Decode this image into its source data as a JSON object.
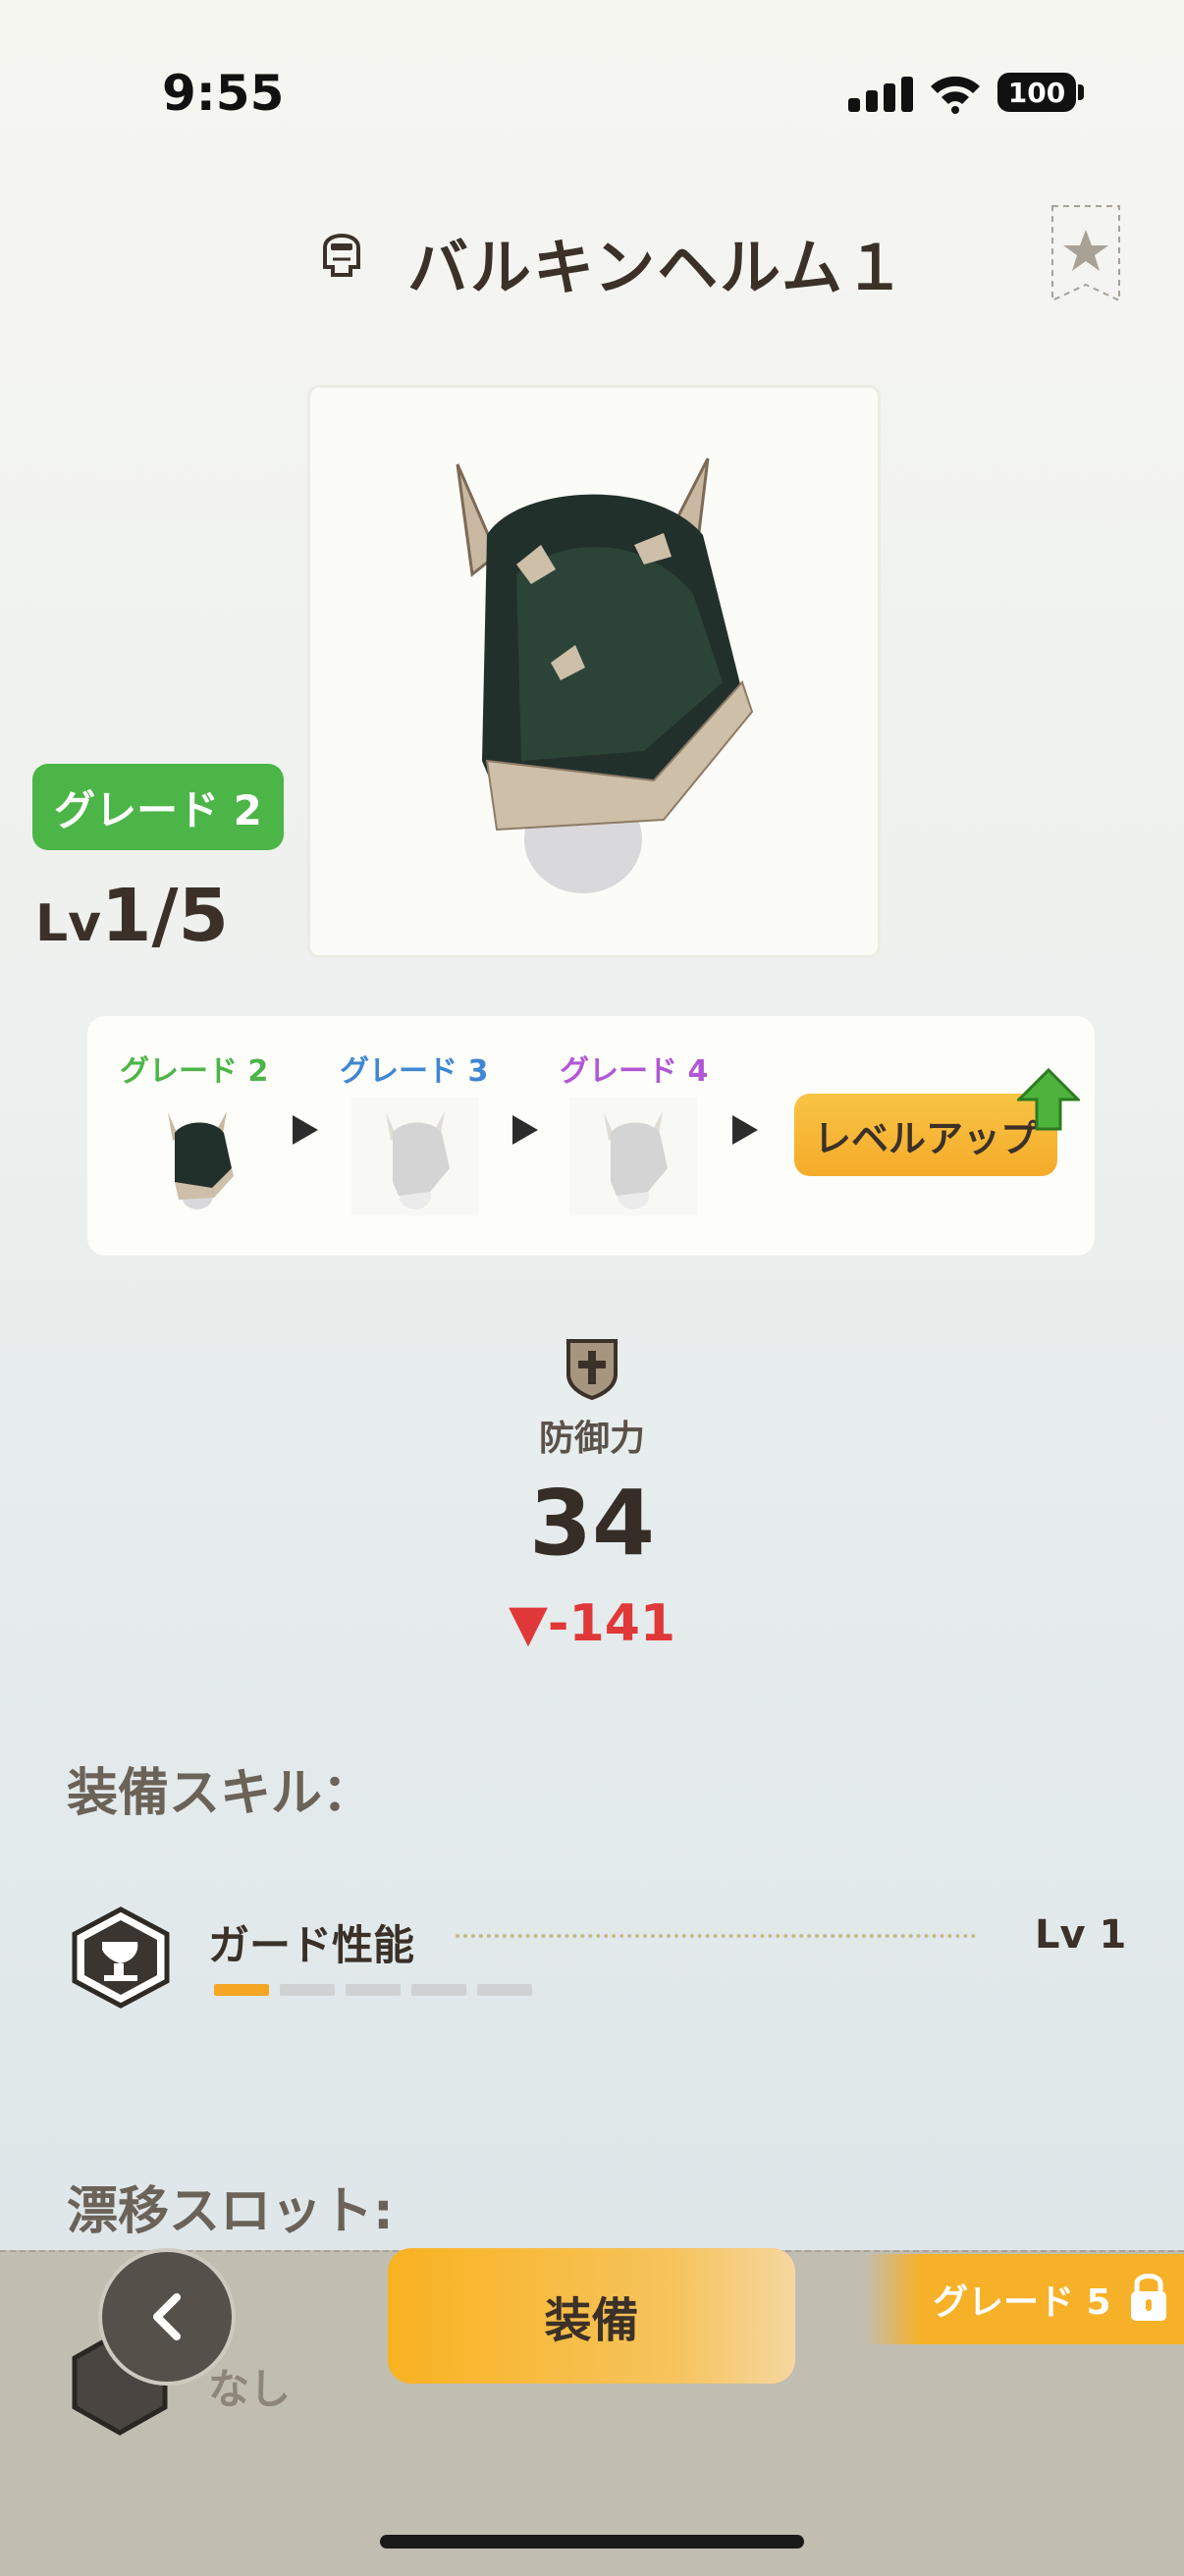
{
  "status_bar": {
    "time": "9:55",
    "battery": "100"
  },
  "header": {
    "title": "バルキンヘルム１"
  },
  "item": {
    "grade_badge": "グレード 2",
    "lv_prefix": "Lv",
    "lv_value": "1/5"
  },
  "progression": {
    "grades": [
      "グレード 2",
      "グレード 3",
      "グレード 4"
    ],
    "grade_colors": [
      "#4cb548",
      "#3f86d4",
      "#b057d6"
    ],
    "level_up_label": "レベルアップ"
  },
  "stats": {
    "defense_label": "防御力",
    "defense_value": "34",
    "defense_diff": "▼-141"
  },
  "skills": {
    "title": "装備スキル：",
    "items": [
      {
        "name": "ガード性能",
        "level": "Lv 1",
        "progress": 1,
        "max": 5
      }
    ]
  },
  "slots": {
    "title": "漂移スロット:",
    "value": "なし"
  },
  "footer": {
    "equip_label": "装備",
    "locked_grade_label": "グレード 5"
  }
}
